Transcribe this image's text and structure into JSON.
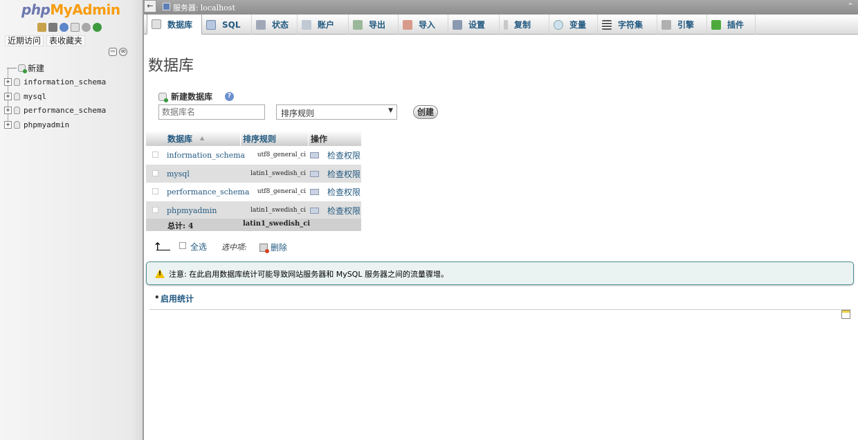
{
  "nav": {
    "logo": {
      "php": "php",
      "my": "My",
      "admin": "Admin"
    },
    "icons": [
      "home-icon",
      "exit-icon",
      "help-icon",
      "docs-icon",
      "settings-icon",
      "reload-icon"
    ],
    "tabs": [
      "近期访问",
      "表收藏夹"
    ],
    "tree": {
      "new": "新建",
      "items": [
        "information_schema",
        "mysql",
        "performance_schema",
        "phpmyadmin"
      ]
    }
  },
  "serverbar": {
    "label": "服务器:",
    "host": "localhost"
  },
  "topmenu": {
    "tabs": [
      {
        "label": "数据库",
        "icon": "database-icon",
        "active": true
      },
      {
        "label": "SQL",
        "icon": "sql-icon"
      },
      {
        "label": "状态",
        "icon": "status-icon"
      },
      {
        "label": "账户",
        "icon": "accounts-icon"
      },
      {
        "label": "导出",
        "icon": "export-icon"
      },
      {
        "label": "导入",
        "icon": "import-icon"
      },
      {
        "label": "设置",
        "icon": "settings-icon"
      },
      {
        "label": "复制",
        "icon": "replication-icon"
      },
      {
        "label": "变量",
        "icon": "variables-icon"
      },
      {
        "label": "字符集",
        "icon": "charset-icon"
      },
      {
        "label": "引擎",
        "icon": "engines-icon"
      },
      {
        "label": "插件",
        "icon": "plugins-icon"
      }
    ]
  },
  "page": {
    "title": "数据库",
    "create": {
      "heading": "新建数据库",
      "placeholder": "数据库名",
      "collation_select": "排序规则",
      "button": "创建"
    },
    "table": {
      "headers": {
        "database": "数据库",
        "collation": "排序规则",
        "action": "操作"
      },
      "rows": [
        {
          "name": "information_schema",
          "collation": "utf8_general_ci",
          "action": "检查权限"
        },
        {
          "name": "mysql",
          "collation": "latin1_swedish_ci",
          "action": "检查权限"
        },
        {
          "name": "performance_schema",
          "collation": "utf8_general_ci",
          "action": "检查权限"
        },
        {
          "name": "phpmyadmin",
          "collation": "latin1_swedish_ci",
          "action": "检查权限"
        }
      ],
      "total_label": "总计: 4",
      "total_collation": "latin1_swedish_ci"
    },
    "bulk": {
      "select_all": "全选",
      "with_selected": "选中项:",
      "delete": "删除"
    },
    "notice": "注意: 在此启用数据库统计可能导致网站服务器和 MySQL 服务器之间的流量骤增。",
    "enable_stats": "启用统计"
  },
  "colors": {
    "link": "#235a81",
    "logo_orange": "#f89c0e",
    "logo_blue": "#6c78af",
    "notice_border": "#4e8e8e"
  }
}
